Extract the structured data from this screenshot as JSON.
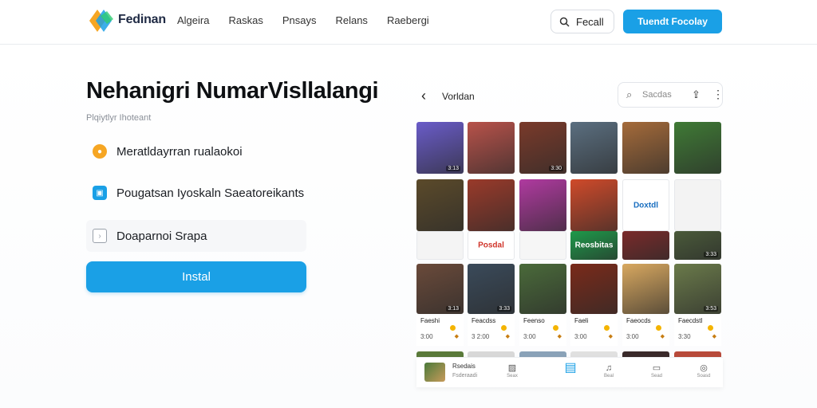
{
  "header": {
    "brand": "Fedinan",
    "nav": [
      "Algeira",
      "Raskas",
      "Pnsays",
      "Relans",
      "Raebergi"
    ],
    "search_label": "Fecall",
    "cta_label": "Tuendt Focolay"
  },
  "hero": {
    "title": "Nehanigri NumarVisllalangi",
    "subtitle": "Plqiytlyr Ihoteant",
    "features": [
      {
        "label": "Meratldayrran rualaokoi",
        "icon": "circle-badge-icon",
        "color": "#f6a623"
      },
      {
        "label": "Pougatsan Iyoskaln Saeatoreikants",
        "icon": "square-badge-icon",
        "color": "#1aa0e6"
      },
      {
        "label": "Doaparnoi Srapa",
        "icon": "document-icon",
        "color": "#9aa1ab"
      }
    ],
    "install_label": "Instal"
  },
  "panel": {
    "title": "Vorldan",
    "search_placeholder": "Sacdas",
    "tiles": [
      {
        "dur": "3:13",
        "text": "",
        "color": "#6a5cc9"
      },
      {
        "dur": "",
        "text": "",
        "color": "#b8524a"
      },
      {
        "dur": "3:30",
        "text": "",
        "color": "#7a3a2a"
      },
      {
        "dur": "",
        "text": "",
        "color": "#5b6f80"
      },
      {
        "dur": "",
        "text": "",
        "color": "#a56b3a"
      },
      {
        "dur": "",
        "text": "",
        "color": "#3f7a35"
      },
      {
        "dur": "",
        "text": "",
        "color": "#5b4a2a"
      },
      {
        "dur": "",
        "text": "",
        "color": "#9a3a2a"
      },
      {
        "dur": "",
        "text": "",
        "color": "#b03aa0"
      },
      {
        "dur": "",
        "text": "",
        "color": "#d04a2a"
      },
      {
        "dur": "",
        "text": "Doxtdl",
        "color": "#ffffff"
      },
      {
        "dur": "",
        "text": "",
        "color": "#f3f3f3"
      },
      {
        "dur": "",
        "text": "",
        "color": "#f4f4f4"
      },
      {
        "dur": "",
        "text": "Posdal",
        "color": "#ffffff"
      },
      {
        "dur": "",
        "text": "",
        "color": "#f6f6f6"
      },
      {
        "dur": "",
        "text": "Reosbitas",
        "color": "#1e9a4a"
      },
      {
        "dur": "",
        "text": "",
        "color": "#7a2a2a"
      },
      {
        "dur": "3:33",
        "text": "",
        "color": "#4a5a3a"
      },
      {
        "dur": "3:13",
        "text": "",
        "color": "#6a4a3a"
      },
      {
        "dur": "3:33",
        "text": "",
        "color": "#3a4a5a"
      },
      {
        "dur": "",
        "text": "",
        "color": "#4a6a3a"
      },
      {
        "dur": "",
        "text": "",
        "color": "#7a2a1a"
      },
      {
        "dur": "",
        "text": "",
        "color": "#d8a860"
      },
      {
        "dur": "3:53",
        "text": "",
        "color": "#6a7a4a"
      }
    ],
    "cards": [
      {
        "name": "Faeshi",
        "price": "3:00"
      },
      {
        "name": "Feacdss",
        "price": "3 2:00"
      },
      {
        "name": "Feenso",
        "price": "3:00"
      },
      {
        "name": "Faeli",
        "price": "3:00"
      },
      {
        "name": "Faeocds",
        "price": "3:00"
      },
      {
        "name": "Faecdstl",
        "price": "3:30"
      }
    ],
    "bottom": {
      "title": "Rsedais",
      "sub": "Fsderaadi",
      "items": [
        {
          "label": "Seax",
          "icon": "image-icon"
        },
        {
          "label": "",
          "icon": "grid-icon"
        },
        {
          "label": "Beal",
          "icon": "bell-icon"
        },
        {
          "label": "Sead",
          "icon": "box-icon"
        },
        {
          "label": "Soasd",
          "icon": "profile-icon"
        }
      ]
    }
  },
  "colors": {
    "accent": "#1aa0e6",
    "text": "#111111"
  }
}
